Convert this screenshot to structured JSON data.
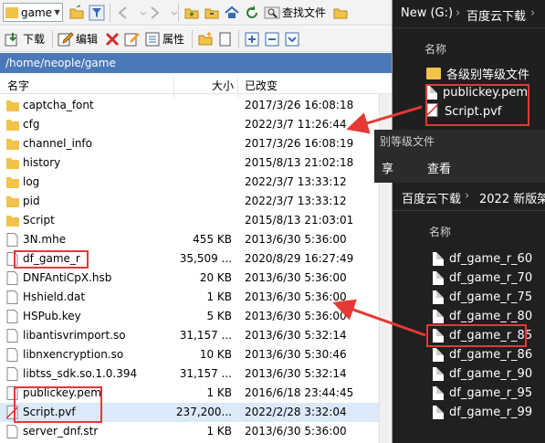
{
  "left_panel": {
    "toolbar": {
      "combo_value": "game",
      "find_label": "查找文件",
      "download_label": "下载",
      "edit_label": "编辑",
      "properties_label": "属性"
    },
    "path": "/home/neople/game",
    "columns": {
      "name": "名字",
      "size": "大小",
      "modified": "已改变"
    },
    "files": [
      {
        "name": "captcha_font",
        "size": "",
        "date": "2017/3/26 16:08:18",
        "type": "folder"
      },
      {
        "name": "cfg",
        "size": "",
        "date": "2022/3/7 11:26:44",
        "type": "folder"
      },
      {
        "name": "channel_info",
        "size": "",
        "date": "2017/3/26 16:08:19",
        "type": "folder"
      },
      {
        "name": "history",
        "size": "",
        "date": "2015/8/13 21:02:18",
        "type": "folder"
      },
      {
        "name": "log",
        "size": "",
        "date": "2022/3/7 13:33:12",
        "type": "folder"
      },
      {
        "name": "pid",
        "size": "",
        "date": "2022/3/7 13:33:12",
        "type": "folder"
      },
      {
        "name": "Script",
        "size": "",
        "date": "2015/8/13 21:03:01",
        "type": "folder"
      },
      {
        "name": "3N.mhe",
        "size": "455 KB",
        "date": "2013/6/30 5:36:00",
        "type": "file"
      },
      {
        "name": "df_game_r",
        "size": "35,509 ...",
        "date": "2020/8/29 16:27:49",
        "type": "file"
      },
      {
        "name": "DNFAntiCpX.hsb",
        "size": "20 KB",
        "date": "2013/6/30 5:36:00",
        "type": "file"
      },
      {
        "name": "Hshield.dat",
        "size": "1 KB",
        "date": "2013/6/30 5:36:00",
        "type": "file"
      },
      {
        "name": "HSPub.key",
        "size": "5 KB",
        "date": "2013/6/30 5:36:00",
        "type": "file"
      },
      {
        "name": "libantisvrimport.so",
        "size": "31,157 ...",
        "date": "2013/6/30 5:32:14",
        "type": "file"
      },
      {
        "name": "libnxencryption.so",
        "size": "10 KB",
        "date": "2013/6/30 5:30:46",
        "type": "file"
      },
      {
        "name": "libtss_sdk.so.1.0.394",
        "size": "31,157 ...",
        "date": "2013/6/30 5:32:14",
        "type": "file"
      },
      {
        "name": "publickey.pem",
        "size": "1 KB",
        "date": "2016/6/18 23:44:45",
        "type": "file"
      },
      {
        "name": "Script.pvf",
        "size": "237,200...",
        "date": "2022/2/28 3:32:04",
        "type": "pvf"
      },
      {
        "name": "server_dnf.str",
        "size": "1 KB",
        "date": "2013/6/30 5:36:00",
        "type": "file"
      }
    ]
  },
  "right_top": {
    "breadcrumb_drive": "New (G:)",
    "breadcrumb_folder": "百度云下载",
    "column_name": "名称",
    "items": [
      {
        "name": "各级别等级文件",
        "type": "folder"
      },
      {
        "name": "publickey.pem",
        "type": "file"
      },
      {
        "name": "Script.pvf",
        "type": "pvf"
      }
    ]
  },
  "right_mid": {
    "title_partial": "别等级文件",
    "menu_share": "享",
    "menu_view": "查看"
  },
  "right_bottom": {
    "breadcrumb_folder": "百度云下载",
    "breadcrumb_sub": "2022 新版架",
    "column_name": "名称",
    "items": [
      "df_game_r_60",
      "df_game_r_70",
      "df_game_r_75",
      "df_game_r_80",
      "df_game_r_85",
      "df_game_r_86",
      "df_game_r_90",
      "df_game_r_95",
      "df_game_r_99"
    ]
  },
  "colors": {
    "path_bar": "#4a78b8",
    "highlight": "#e53935",
    "folder": "#f2c24a",
    "selected_row": "#dbe9f8"
  }
}
